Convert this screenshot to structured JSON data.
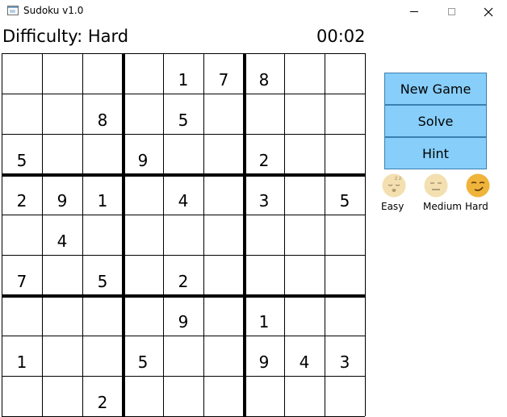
{
  "window": {
    "title": "Sudoku v1.0"
  },
  "header": {
    "difficulty": "Difficulty: Hard",
    "timer": "00:02"
  },
  "board": [
    [
      "",
      "",
      "",
      "",
      "1",
      "7",
      "8",
      "",
      ""
    ],
    [
      "",
      "",
      "8",
      "",
      "5",
      "",
      "",
      "",
      ""
    ],
    [
      "5",
      "",
      "",
      "9",
      "",
      "",
      "2",
      "",
      ""
    ],
    [
      "2",
      "9",
      "1",
      "",
      "4",
      "",
      "3",
      "",
      "5"
    ],
    [
      "",
      "4",
      "",
      "",
      "",
      "",
      "",
      "",
      ""
    ],
    [
      "7",
      "",
      "5",
      "",
      "2",
      "",
      "",
      "",
      ""
    ],
    [
      "",
      "",
      "",
      "",
      "9",
      "",
      "1",
      "",
      ""
    ],
    [
      "1",
      "",
      "",
      "5",
      "",
      "",
      "9",
      "4",
      "3"
    ],
    [
      "",
      "",
      "2",
      "",
      "",
      "",
      "",
      "",
      ""
    ]
  ],
  "menu": {
    "new_game": "New Game",
    "solve": "Solve",
    "hint": "Hint"
  },
  "levels": [
    {
      "label": "Easy",
      "icon": "sleepy-face-icon"
    },
    {
      "label": "Medium",
      "icon": "neutral-face-icon"
    },
    {
      "label": "Hard",
      "icon": "smirk-face-icon",
      "selected": true
    }
  ],
  "colors": {
    "button_bg": "#87cefa",
    "face_inactive": "#f3dfb0",
    "face_active": "#f0b43a"
  }
}
